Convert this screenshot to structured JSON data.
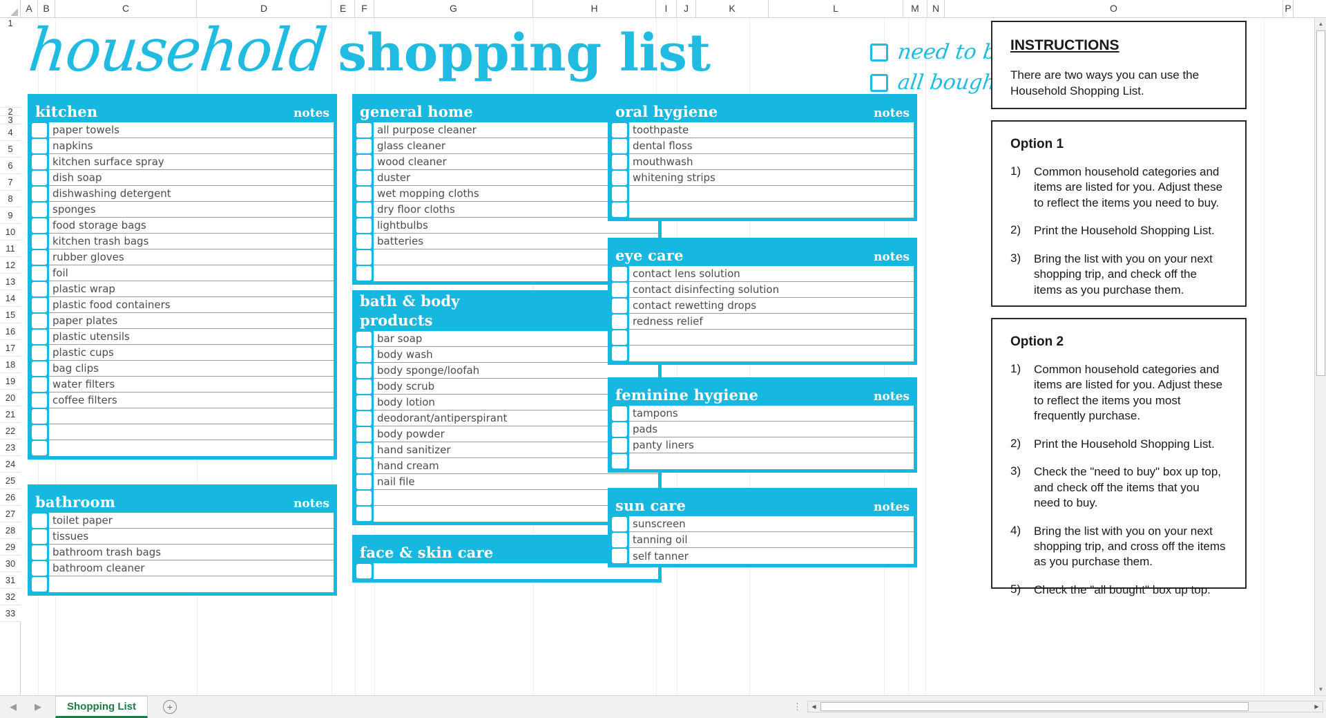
{
  "workbook": {
    "column_headers": [
      "A",
      "B",
      "C",
      "D",
      "E",
      "F",
      "G",
      "H",
      "I",
      "J",
      "K",
      "L",
      "M",
      "N",
      "O",
      "P"
    ],
    "row_headers": [
      "1",
      "2",
      "3",
      "4",
      "5",
      "6",
      "7",
      "8",
      "9",
      "10",
      "11",
      "12",
      "13",
      "14",
      "15",
      "16",
      "17",
      "18",
      "19",
      "20",
      "21",
      "22",
      "23",
      "24",
      "25",
      "26",
      "27",
      "28",
      "29",
      "30",
      "31",
      "32",
      "33"
    ],
    "sheet_tab": "Shopping List",
    "add_sheet_icon": "plus-circle-icon",
    "nav_prev_icon": "chevron-left-icon",
    "nav_next_icon": "chevron-right-icon"
  },
  "accent_color": "#17b8e0",
  "title": {
    "script_word": "household",
    "bold_words": "shopping list"
  },
  "status_checks": [
    {
      "label": "need to buy",
      "checked": false
    },
    {
      "label": "all bought",
      "checked": false
    }
  ],
  "notes_label": "notes",
  "categories": [
    {
      "id": "kitchen",
      "title": "kitchen",
      "items": [
        "paper towels",
        "napkins",
        "kitchen surface spray",
        "dish soap",
        "dishwashing detergent",
        "sponges",
        "food storage bags",
        "kitchen trash bags",
        "rubber gloves",
        "foil",
        "plastic wrap",
        "plastic food containers",
        "paper plates",
        "plastic utensils",
        "plastic cups",
        "bag clips",
        "water filters",
        "coffee filters",
        "",
        "",
        ""
      ]
    },
    {
      "id": "bathroom",
      "title": "bathroom",
      "items": [
        "toilet paper",
        "tissues",
        "bathroom trash bags",
        "bathroom cleaner",
        ""
      ]
    },
    {
      "id": "general-home",
      "title": "general home",
      "items": [
        "all purpose cleaner",
        "glass cleaner",
        "wood cleaner",
        "duster",
        "wet mopping cloths",
        "dry floor cloths",
        "lightbulbs",
        "batteries",
        "",
        ""
      ]
    },
    {
      "id": "bath-body-products",
      "title": "bath & body",
      "title_line2": "products",
      "items": [
        "bar soap",
        "body wash",
        "body sponge/loofah",
        "body scrub",
        "body lotion",
        "deodorant/antiperspirant",
        "body powder",
        "hand sanitizer",
        "hand cream",
        "nail file",
        "",
        ""
      ]
    },
    {
      "id": "face-skin-care",
      "title": "face & skin care",
      "items": [
        ""
      ]
    },
    {
      "id": "oral-hygiene",
      "title": "oral hygiene",
      "items": [
        "toothpaste",
        "dental floss",
        "mouthwash",
        "whitening strips",
        "",
        ""
      ]
    },
    {
      "id": "eye-care",
      "title": "eye care",
      "items": [
        "contact lens solution",
        "contact disinfecting solution",
        "contact rewetting drops",
        "redness relief",
        "",
        ""
      ]
    },
    {
      "id": "feminine-hygiene",
      "title": "feminine hygiene",
      "items": [
        "tampons",
        "pads",
        "panty liners",
        ""
      ]
    },
    {
      "id": "sun-care",
      "title": "sun care",
      "items": [
        "sunscreen",
        "tanning oil",
        "self tanner"
      ]
    }
  ],
  "instructions": {
    "heading": "INSTRUCTIONS",
    "body": "There are two ways you can use the Household Shopping List.",
    "option1": {
      "title": "Option 1",
      "steps": [
        {
          "num": "1)",
          "text": "Common household categories and items are listed for you.  Adjust these to reflect the items you need to buy."
        },
        {
          "num": "2)",
          "text": "Print the Household Shopping List."
        },
        {
          "num": "3)",
          "text": "Bring the list with you on your next shopping trip, and check off the items as you purchase them."
        }
      ]
    },
    "option2": {
      "title": "Option 2",
      "steps": [
        {
          "num": "1)",
          "text": "Common household categories and items are listed for you.  Adjust these to reflect the items you most frequently purchase."
        },
        {
          "num": "2)",
          "text": "Print the Household Shopping List."
        },
        {
          "num": "3)",
          "text": "Check the \"need to buy\" box up top, and check off the items that you need to buy."
        },
        {
          "num": "4)",
          "text": "Bring the list with you on your next shopping trip, and cross off the items as you purchase them."
        },
        {
          "num": "5)",
          "text": "Check the \"all bought\" box up top."
        }
      ]
    }
  }
}
